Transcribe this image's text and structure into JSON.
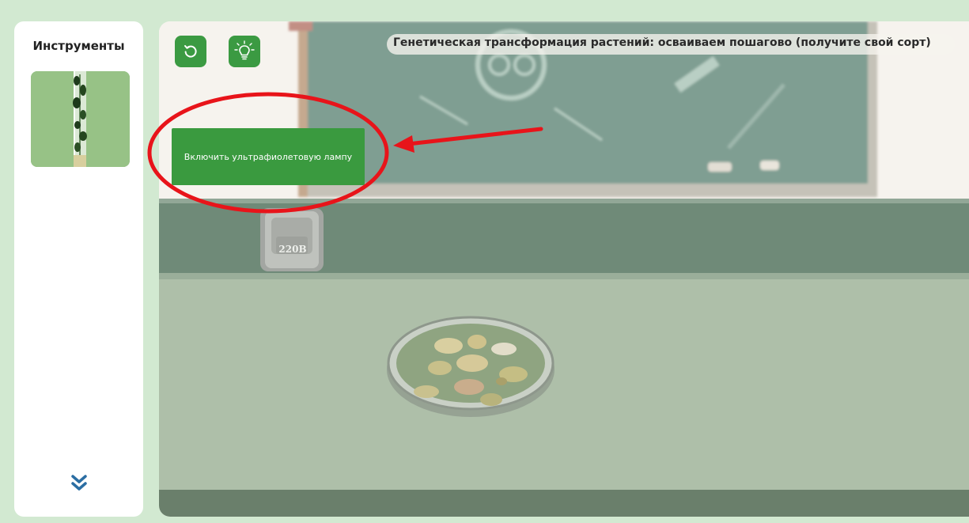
{
  "sidebar": {
    "title": "Инструменты",
    "tools": [
      {
        "name": "test-tube-with-plants"
      }
    ],
    "scroll_icon": "double-chevron-down-icon"
  },
  "toolbar": {
    "reset_icon": "reset-icon",
    "hint_icon": "lightbulb-icon"
  },
  "header": {
    "title": "Генетическая трансформация растений: осваиваем пошагово (получите свой сорт)"
  },
  "action": {
    "uv_lamp_label": "Включить ультрафиолетовую лампу"
  },
  "scene": {
    "socket_label": "220В",
    "objects": [
      "chalkboard",
      "wall-socket",
      "lab-bench",
      "petri-dish-with-calli"
    ]
  },
  "annotation": {
    "shape": "red-ellipse-with-arrow",
    "color": "#e8141a"
  },
  "colors": {
    "accent_green": "#3a9a3f",
    "page_bg": "#d2e9d1",
    "bench": "#aebfa9"
  }
}
